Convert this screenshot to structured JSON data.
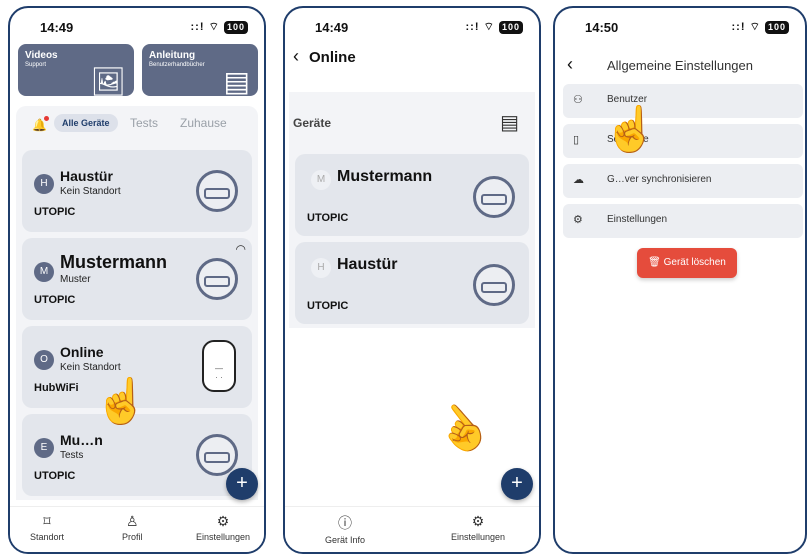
{
  "colors": {
    "primary": "#1f3d6b",
    "banner": "#5f6a86",
    "danger": "#e54c3c",
    "card": "#e3e6ec"
  },
  "phone1": {
    "time": "14:49",
    "signal": "::!",
    "battery": "100",
    "banners": [
      {
        "title": "Videos",
        "subtitle": "Support",
        "icon": "video-gallery-icon"
      },
      {
        "title": "Anleitung",
        "subtitle": "Benutzerhandbücher",
        "icon": "document-icon"
      }
    ],
    "filters": [
      "Alle Geräte",
      "Tests",
      "Zuhause"
    ],
    "devices": [
      {
        "avatar": "H",
        "name": "Haustür",
        "subtitle": "Kein Standort",
        "type": "UTOPIC",
        "icon": "smart-lock-icon"
      },
      {
        "avatar": "M",
        "name": "Mustermann",
        "subtitle": "Muster",
        "type": "UTOPIC",
        "icon": "smart-lock-icon"
      },
      {
        "avatar": "O",
        "name": "Online",
        "subtitle": "Kein Standort",
        "type": "HubWiFi",
        "icon": "hub-device-icon"
      },
      {
        "avatar": "E",
        "name": "Mu…n",
        "subtitle": "Tests",
        "type": "UTOPIC",
        "icon": "smart-lock-icon"
      }
    ],
    "fab": "+",
    "tabs": [
      {
        "label": "Standort",
        "icon": "bookmark-icon"
      },
      {
        "label": "Profil",
        "icon": "person-icon"
      },
      {
        "label": "Einstellungen",
        "icon": "gear-icon"
      }
    ]
  },
  "phone2": {
    "time": "14:49",
    "signal": "::!",
    "battery": "100",
    "title": "Online",
    "section": "Geräte",
    "devices": [
      {
        "avatar": "M",
        "name": "Mustermann",
        "type": "UTOPIC"
      },
      {
        "avatar": "H",
        "name": "Haustür",
        "type": "UTOPIC"
      }
    ],
    "fab": "+",
    "tabs": [
      {
        "label": "Gerät Info",
        "icon": "info-icon"
      },
      {
        "label": "Einstellungen",
        "icon": "gear-icon"
      }
    ]
  },
  "phone3": {
    "time": "14:50",
    "signal": "::!",
    "battery": "100",
    "title": "Allgemeine Einstellungen",
    "rows": [
      {
        "label": "Benutzer",
        "icon": "users-icon"
      },
      {
        "label": "So…date",
        "icon": "phone-update-icon"
      },
      {
        "label": "G…ver synchronisieren",
        "icon": "cloud-sync-icon"
      },
      {
        "label": "Einstellungen",
        "icon": "gear-icon"
      }
    ],
    "delete_label": "Gerät löschen"
  }
}
